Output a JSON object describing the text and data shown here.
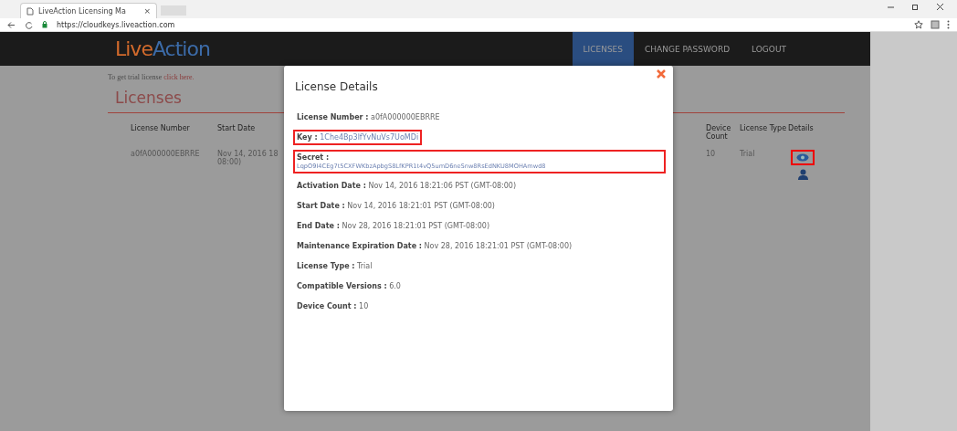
{
  "browser": {
    "tab_title": "LiveAction Licensing Ma",
    "tab_close": "×",
    "url": "https://cloudkeys.liveaction.com"
  },
  "nav": {
    "logo": {
      "part_1": "Live",
      "part_2": "Action"
    },
    "items": [
      {
        "label": "LICENSES",
        "selected": true
      },
      {
        "label": "CHANGE PASSWORD",
        "selected": false
      },
      {
        "label": "LOGOUT",
        "selected": false
      }
    ]
  },
  "page": {
    "trial_note": {
      "text": "To get trial license",
      "link": "click here."
    },
    "heading": "Licenses",
    "table": {
      "columns": [
        "License Number",
        "Start Date",
        "Device Count",
        "License Type",
        "Details"
      ],
      "rows": [
        {
          "license_number": "a0fA000000EBRRE",
          "start_date": [
            "Nov 14, 2016 18",
            "08:00)"
          ],
          "device_count": "10",
          "license_type": "Trial",
          "details_highlighted": true
        }
      ]
    }
  },
  "dialog": {
    "title": "License Details",
    "fields": [
      {
        "kind": "inline",
        "label": "License Number :",
        "value": "a0fA000000EBRRE",
        "highlighted": false
      },
      {
        "kind": "inline",
        "label": "Key :",
        "value": "1Che4Bp3lfYvNuVs7UoMDi",
        "highlighted": true
      },
      {
        "kind": "block",
        "label": "Secret :",
        "value": "LqpO9I4CEg7t5CXFWKbzApbgS8LfKPR1t4vQ5umD6neSnw8RsEdNKU8MOHAmwd8",
        "highlighted": true
      },
      {
        "kind": "inline",
        "label": "Activation Date :",
        "value": "Nov 14, 2016 18:21:06 PST (GMT-08:00)",
        "highlighted": false
      },
      {
        "kind": "inline",
        "label": "Start Date :",
        "value": "Nov 14, 2016 18:21:01 PST (GMT-08:00)",
        "highlighted": false
      },
      {
        "kind": "inline",
        "label": "End Date :",
        "value": "Nov 28, 2016 18:21:01 PST (GMT-08:00)",
        "highlighted": false
      },
      {
        "kind": "inline",
        "label": "Maintenance Expiration Date :",
        "value": "Nov 28, 2016 18:21:01 PST (GMT-08:00)",
        "highlighted": false
      },
      {
        "kind": "inline",
        "label": "License Type :",
        "value": "Trial",
        "highlighted": false
      },
      {
        "kind": "inline",
        "label": "Compatible Versions :",
        "value": "6.0",
        "highlighted": false
      },
      {
        "kind": "inline",
        "label": "Device Count :",
        "value": "10",
        "highlighted": false
      }
    ]
  }
}
